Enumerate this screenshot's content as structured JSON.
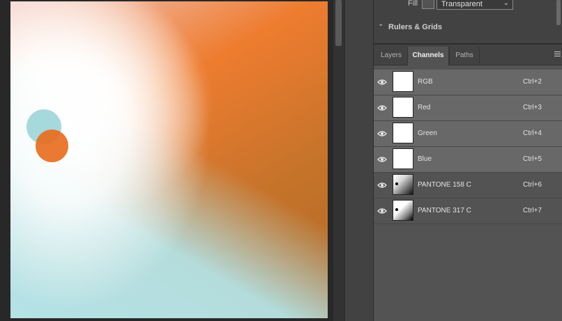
{
  "properties": {
    "fill_label": "Fill",
    "fill_value": "Transparent",
    "section_title": "Rulers & Grids"
  },
  "tabs": [
    {
      "label": "Layers",
      "active": false
    },
    {
      "label": "Channels",
      "active": true
    },
    {
      "label": "Paths",
      "active": false
    }
  ],
  "channels": [
    {
      "name": "RGB",
      "shortcut": "Ctrl+2",
      "selected": true
    },
    {
      "name": "Red",
      "shortcut": "Ctrl+3",
      "selected": true
    },
    {
      "name": "Green",
      "shortcut": "Ctrl+4",
      "selected": true
    },
    {
      "name": "Blue",
      "shortcut": "Ctrl+5",
      "selected": true
    },
    {
      "name": "PANTONE 158 C",
      "shortcut": "Ctrl+6",
      "selected": false
    },
    {
      "name": "PANTONE 317 C",
      "shortcut": "Ctrl+7",
      "selected": false
    }
  ],
  "colors": {
    "canvas_orange": "#ee7c2f",
    "canvas_cyan": "#b4e2e6",
    "panel_bg": "#535353",
    "selected_row": "#686868"
  }
}
